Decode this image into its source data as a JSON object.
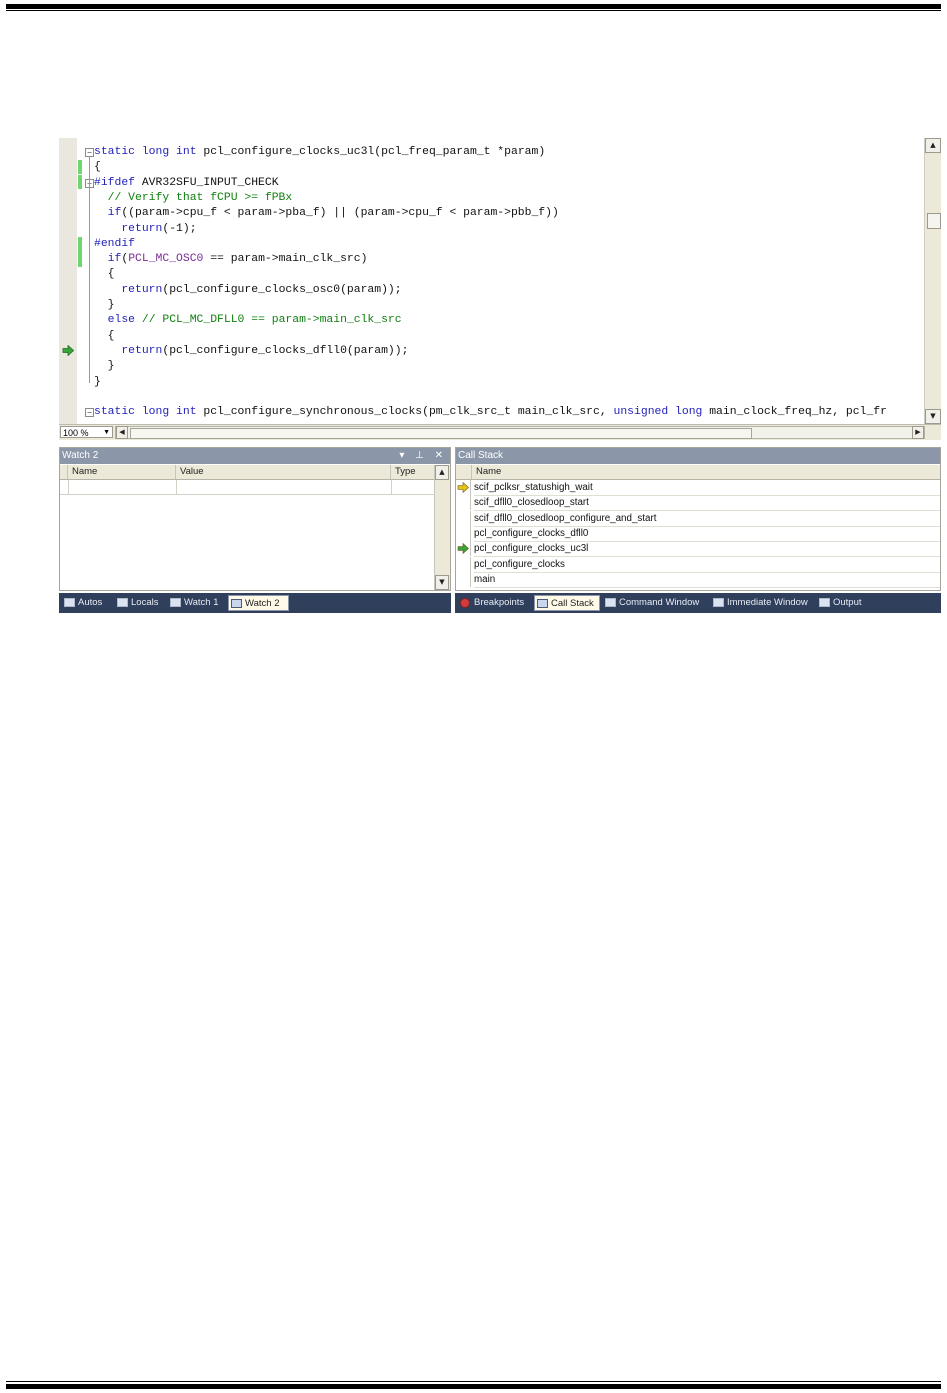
{
  "editor": {
    "zoom": "100 %",
    "lines": [
      {
        "fold": "−",
        "parts": [
          [
            "kw",
            "static long int"
          ],
          [
            "t",
            " pcl_configure_clocks_uc3l(pcl_freq_param_t *param)"
          ]
        ]
      },
      {
        "parts": [
          [
            "t",
            "{"
          ]
        ]
      },
      {
        "fold": "−",
        "parts": [
          [
            "pp",
            "#ifdef"
          ],
          [
            "t",
            " AVR32SFU_INPUT_CHECK"
          ]
        ]
      },
      {
        "parts": [
          [
            "t",
            "  "
          ],
          [
            "cm",
            "// Verify that fCPU >= fPBx"
          ]
        ]
      },
      {
        "parts": [
          [
            "t",
            "  "
          ],
          [
            "kw",
            "if"
          ],
          [
            "t",
            "((param->cpu_f < param->pba_f) || (param->cpu_f < param->pbb_f))"
          ]
        ]
      },
      {
        "parts": [
          [
            "t",
            "    "
          ],
          [
            "kw",
            "return"
          ],
          [
            "t",
            "(-1);"
          ]
        ]
      },
      {
        "parts": [
          [
            "pp",
            "#endif"
          ]
        ]
      },
      {
        "parts": [
          [
            "t",
            "  "
          ],
          [
            "kw",
            "if"
          ],
          [
            "t",
            "("
          ],
          [
            "mc",
            "PCL_MC_OSC0"
          ],
          [
            "t",
            " == param->main_clk_src)"
          ]
        ]
      },
      {
        "parts": [
          [
            "t",
            "  {"
          ]
        ]
      },
      {
        "parts": [
          [
            "t",
            "    "
          ],
          [
            "kw",
            "return"
          ],
          [
            "t",
            "(pcl_configure_clocks_osc0(param));"
          ]
        ]
      },
      {
        "parts": [
          [
            "t",
            "  }"
          ]
        ]
      },
      {
        "parts": [
          [
            "t",
            "  "
          ],
          [
            "kw",
            "else"
          ],
          [
            "t",
            " "
          ],
          [
            "cm",
            "// PCL_MC_DFLL0 == param->main_clk_src"
          ]
        ]
      },
      {
        "parts": [
          [
            "t",
            "  {"
          ]
        ]
      },
      {
        "parts": [
          [
            "t",
            "    "
          ],
          [
            "kw",
            "return"
          ],
          [
            "t",
            "(pcl_configure_clocks_dfll0(param));"
          ]
        ]
      },
      {
        "parts": [
          [
            "t",
            "  }"
          ]
        ]
      },
      {
        "parts": [
          [
            "t",
            "}"
          ]
        ]
      },
      {
        "parts": [
          [
            "t",
            ""
          ]
        ]
      },
      {
        "fold": "−",
        "parts": [
          [
            "kw",
            "static long int"
          ],
          [
            "t",
            " pcl_configure_synchronous_clocks(pm_clk_src_t main_clk_src, "
          ],
          [
            "kw",
            "unsigned long"
          ],
          [
            "t",
            " main_clock_freq_hz, pcl_fr"
          ]
        ]
      }
    ]
  },
  "watch": {
    "title": "Watch 2",
    "buttons": "▾ ⊥ ✕",
    "columns": [
      "Name",
      "Value",
      "Type"
    ]
  },
  "callstack": {
    "title": "Call Stack",
    "column": "Name",
    "rows": [
      {
        "name": "scif_pclksr_statushigh_wait",
        "marker": "current"
      },
      {
        "name": "scif_dfll0_closedloop_start",
        "marker": ""
      },
      {
        "name": "scif_dfll0_closedloop_configure_and_start",
        "marker": ""
      },
      {
        "name": "pcl_configure_clocks_dfll0",
        "marker": ""
      },
      {
        "name": "pcl_configure_clocks_uc3l",
        "marker": "frame"
      },
      {
        "name": "pcl_configure_clocks",
        "marker": ""
      },
      {
        "name": "main",
        "marker": ""
      }
    ]
  },
  "tabs_left": [
    {
      "label": "Autos",
      "active": false
    },
    {
      "label": "Locals",
      "active": false
    },
    {
      "label": "Watch 1",
      "active": false
    },
    {
      "label": "Watch 2",
      "active": true
    }
  ],
  "tabs_right": [
    {
      "label": "Breakpoints",
      "active": false,
      "icon": "breakpoint"
    },
    {
      "label": "Call Stack",
      "active": true,
      "icon": "callstack"
    },
    {
      "label": "Command Window",
      "active": false,
      "icon": "window"
    },
    {
      "label": "Immediate Window",
      "active": false,
      "icon": "window"
    },
    {
      "label": "Output",
      "active": false,
      "icon": "window"
    }
  ],
  "colors": {
    "current_arrow": "#e6c21a",
    "frame_arrow": "#3aa33a",
    "change_bar": "#6fd66f",
    "tab_bar": "#2f3f5c"
  }
}
